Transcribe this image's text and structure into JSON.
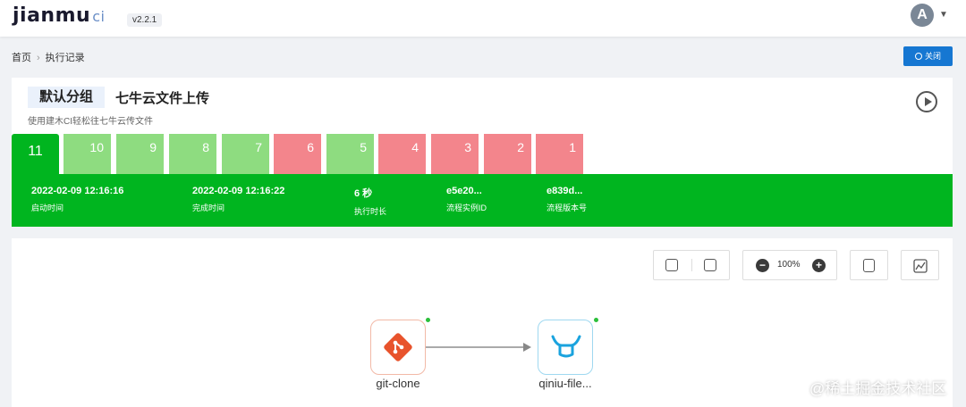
{
  "app": {
    "logo_text": "jianmu",
    "logo_suffix": "ci",
    "version": "v2.2.1",
    "avatar_letter": "A"
  },
  "breadcrumb": {
    "home": "首页",
    "current": "执行记录"
  },
  "close_button": "关闭",
  "project": {
    "group": "默认分组",
    "name": "七牛云文件上传",
    "description": "使用建木CI轻松往七牛云传文件"
  },
  "runs": [
    {
      "label": "11",
      "status": "running"
    },
    {
      "label": "10",
      "status": "success"
    },
    {
      "label": "9",
      "status": "success"
    },
    {
      "label": "8",
      "status": "success"
    },
    {
      "label": "7",
      "status": "success"
    },
    {
      "label": "6",
      "status": "fail"
    },
    {
      "label": "5",
      "status": "success"
    },
    {
      "label": "4",
      "status": "fail"
    },
    {
      "label": "3",
      "status": "fail"
    },
    {
      "label": "2",
      "status": "fail"
    },
    {
      "label": "1",
      "status": "fail"
    }
  ],
  "run_info": [
    {
      "value": "2022-02-09 12:16:16",
      "label": "启动时间"
    },
    {
      "value": "2022-02-09 12:16:22",
      "label": "完成时间"
    },
    {
      "value": "6 秒",
      "label": "执行时长"
    },
    {
      "value": "e5e20...",
      "label": "流程实例ID"
    },
    {
      "value": "e839d...",
      "label": "流程版本号"
    }
  ],
  "toolbar": {
    "zoom": "100%"
  },
  "nodes": [
    {
      "label": "git-clone",
      "icon": "git-icon"
    },
    {
      "label": "qiniu-file...",
      "icon": "qiniu-bull-icon"
    }
  ],
  "colors": {
    "running": "#00b51f",
    "success": "#8edc80",
    "fail": "#f3858c",
    "primary": "#1677d2"
  },
  "watermark": "@稀土掘金技术社区"
}
